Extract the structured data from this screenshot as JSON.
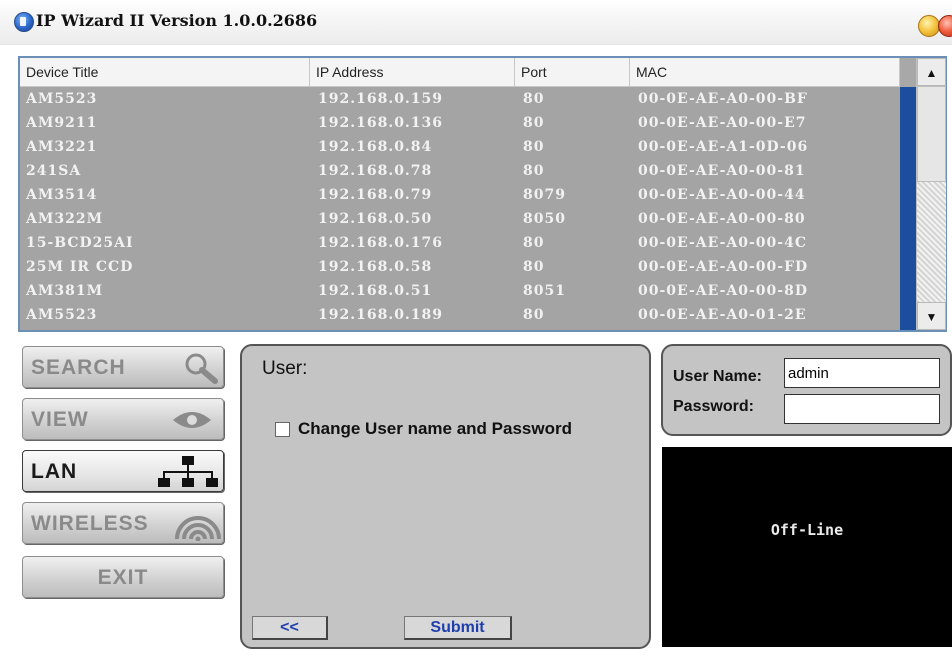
{
  "window": {
    "title": "IP Wizard II  Version 1.0.0.2686"
  },
  "device_list": {
    "columns": [
      "Device Title",
      "IP Address",
      "Port",
      "MAC"
    ],
    "rows": [
      [
        "AM5523",
        "192.168.0.159",
        "80",
        "00-0E-AE-A0-00-BF"
      ],
      [
        "AM9211",
        "192.168.0.136",
        "80",
        "00-0E-AE-A0-00-E7"
      ],
      [
        "AM3221",
        "192.168.0.84",
        "80",
        "00-0E-AE-A1-0D-06"
      ],
      [
        "241SA",
        "192.168.0.78",
        "80",
        "00-0E-AE-A0-00-81"
      ],
      [
        "AM3514",
        "192.168.0.79",
        "8079",
        "00-0E-AE-A0-00-44"
      ],
      [
        "AM322M",
        "192.168.0.50",
        "8050",
        "00-0E-AE-A0-00-80"
      ],
      [
        "15-BCD25AI",
        "192.168.0.176",
        "80",
        "00-0E-AE-A0-00-4C"
      ],
      [
        "25M IR CCD",
        "192.168.0.58",
        "80",
        "00-0E-AE-A0-00-FD"
      ],
      [
        "AM381M",
        "192.168.0.51",
        "8051",
        "00-0E-AE-A0-00-8D"
      ],
      [
        "AM5523",
        "192.168.0.189",
        "80",
        "00-0E-AE-A0-01-2E"
      ]
    ]
  },
  "nav": {
    "search": "SEARCH",
    "view": "VIEW",
    "lan": "LAN",
    "wireless": "WIRELESS",
    "exit": "EXIT",
    "active": "lan"
  },
  "user_panel": {
    "title": "User:",
    "checkbox_label": "Change User name and Password",
    "checkbox_checked": false,
    "back_label": "<<",
    "submit_label": "Submit"
  },
  "credentials": {
    "username_label": "User Name:",
    "username_value": "admin",
    "password_label": "Password:",
    "password_value": ""
  },
  "video": {
    "status": "Off-Line"
  },
  "icons": {
    "app": "ip-wizard-app-icon",
    "search": "magnifier-icon",
    "view": "eye-icon",
    "lan": "network-tree-icon",
    "wireless": "wireless-signal-icon"
  },
  "colors": {
    "selection_blue": "#1c4e9e",
    "list_row_bg": "#a4a4a4",
    "button_text_blue": "#1f3fae"
  }
}
